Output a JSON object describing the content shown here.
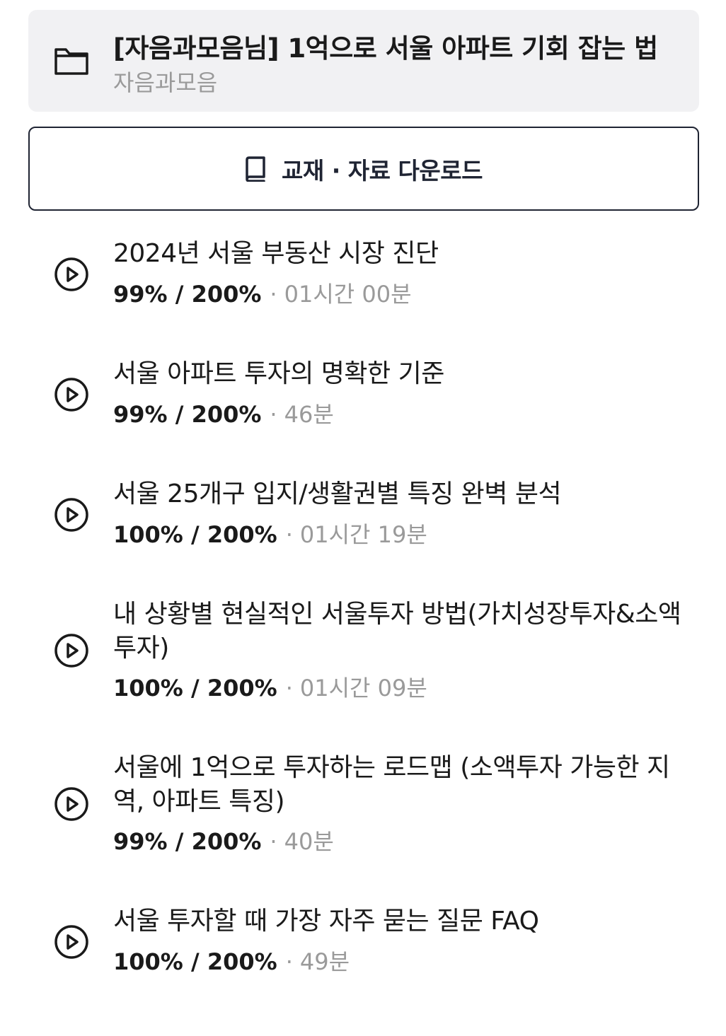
{
  "course": {
    "icon": "folder-icon",
    "title": "[자음과모음님] 1억으로 서울 아파트 기회 잡는 법",
    "author": "자음과모음"
  },
  "download": {
    "icon": "book-icon",
    "label": "교재 · 자료 다운로드"
  },
  "lessons": [
    {
      "icon": "play-icon",
      "title": "2024년 서울 부동산 시장 진단",
      "progress": "99% / 200%",
      "separator": "·",
      "duration": "01시간 00분"
    },
    {
      "icon": "play-icon",
      "title": "서울 아파트 투자의 명확한 기준",
      "progress": "99% / 200%",
      "separator": "·",
      "duration": "46분"
    },
    {
      "icon": "play-icon",
      "title": "서울 25개구 입지/생활권별 특징 완벽 분석",
      "progress": "100% / 200%",
      "separator": "·",
      "duration": "01시간 19분"
    },
    {
      "icon": "play-icon",
      "title": "내 상황별 현실적인 서울투자 방법(가치성장투자&소액투자)",
      "progress": "100% / 200%",
      "separator": "·",
      "duration": "01시간 09분"
    },
    {
      "icon": "play-icon",
      "title": "서울에 1억으로 투자하는 로드맵 (소액투자 가능한 지역, 아파트 특징)",
      "progress": "99% / 200%",
      "separator": "·",
      "duration": "40분"
    },
    {
      "icon": "play-icon",
      "title": "서울 투자할 때 가장 자주 묻는 질문 FAQ",
      "progress": "100% / 200%",
      "separator": "·",
      "duration": "49분"
    }
  ],
  "colors": {
    "header_bg": "#f1f1f3",
    "primary_text": "#1a1a1a",
    "secondary_text": "#9a9a9a",
    "button_border": "#1f2433"
  }
}
